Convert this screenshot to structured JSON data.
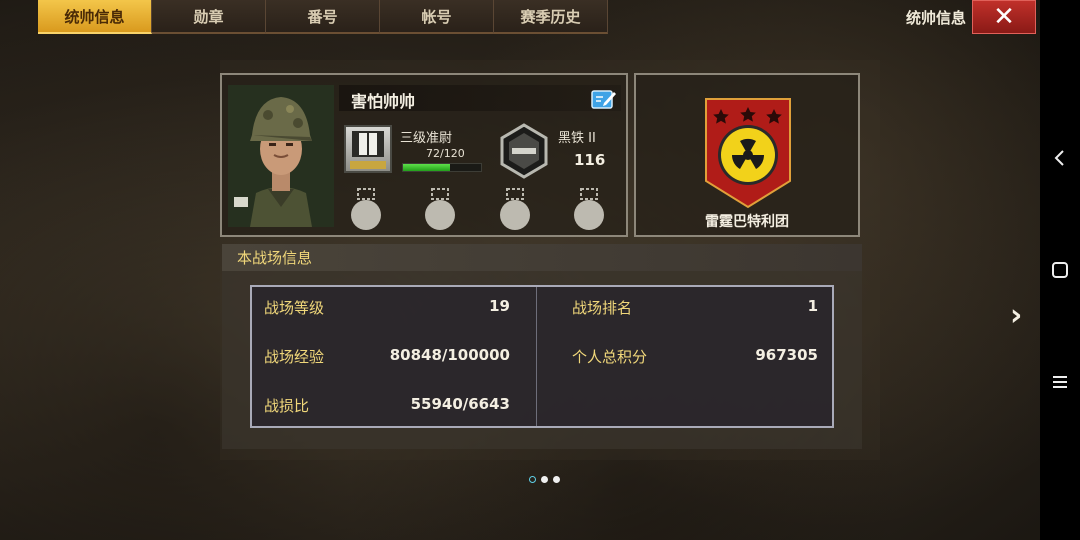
{
  "tabs": [
    {
      "label": "统帅信息",
      "active": true
    },
    {
      "label": "勋章",
      "active": false
    },
    {
      "label": "番号",
      "active": false
    },
    {
      "label": "帐号",
      "active": false
    },
    {
      "label": "赛季历史",
      "active": false
    }
  ],
  "header": {
    "title": "统帅信息",
    "close_icon": "close-icon"
  },
  "player": {
    "name": "害怕帅帅",
    "rank": "三级准尉",
    "exp": "72/120",
    "exp_progress": 0.6,
    "league": "黑铁 II",
    "league_score": "116",
    "medal_slots": 4
  },
  "legion": {
    "name": "雷霆巴特利团",
    "stars": 3
  },
  "battlefield": {
    "section_title": "本战场信息",
    "stats": [
      {
        "label": "战场等级",
        "value": "19"
      },
      {
        "label": "战场排名",
        "value": "1"
      },
      {
        "label": "战场经验",
        "value": "80848/100000"
      },
      {
        "label": "个人总积分",
        "value": "967305"
      },
      {
        "label": "战损比",
        "value": "55940/6643"
      }
    ]
  },
  "pagination": {
    "total": 3,
    "current": 1
  },
  "colors": {
    "accent_gold": "#f0d77a",
    "tab_active": "#e6aa2c",
    "close_red": "#b02a24",
    "exp_green": "#3ec42e"
  }
}
